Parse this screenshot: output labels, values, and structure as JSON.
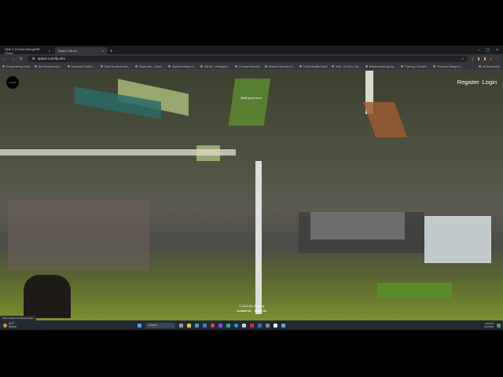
{
  "browser": {
    "tabs": [
      {
        "label": "Slab 2 (Cloud) MongoDB Cloud",
        "active": false
      },
      {
        "label": "Space Sauce",
        "active": true
      }
    ],
    "url": "space.com/fp.dev",
    "bookmarks": [
      "Programming Tools",
      "Be Revolutionary ...",
      "Advanced Flask's ...",
      "Data Structure and ...",
      "Data Labs - Unive...",
      "Systems today m...",
      "GitHub - shokugme...",
      "Contract Benefits",
      "Student Success Pr...",
      "North Seattle Email",
      "Mail - Si Zorro, Na...",
      "Bioinformatology Ap...",
      "Tutoring | Student...",
      "Read the Manga G..."
    ],
    "all_bookmarks": "All Bookmarks",
    "status_url": "https://space.com/fp.dev/login"
  },
  "page": {
    "logo": "LOGO",
    "stuff": "Stuff goes here",
    "register": "Register",
    "login": "Login",
    "copyright": "© 2024 Our Building",
    "contact": "Contact Us",
    "about": "About Us"
  },
  "taskbar": {
    "weather_temp": "59°F",
    "weather_desc": "Sunny",
    "search": "Search",
    "time": "3:55 PM",
    "date": "5/1/2024"
  }
}
